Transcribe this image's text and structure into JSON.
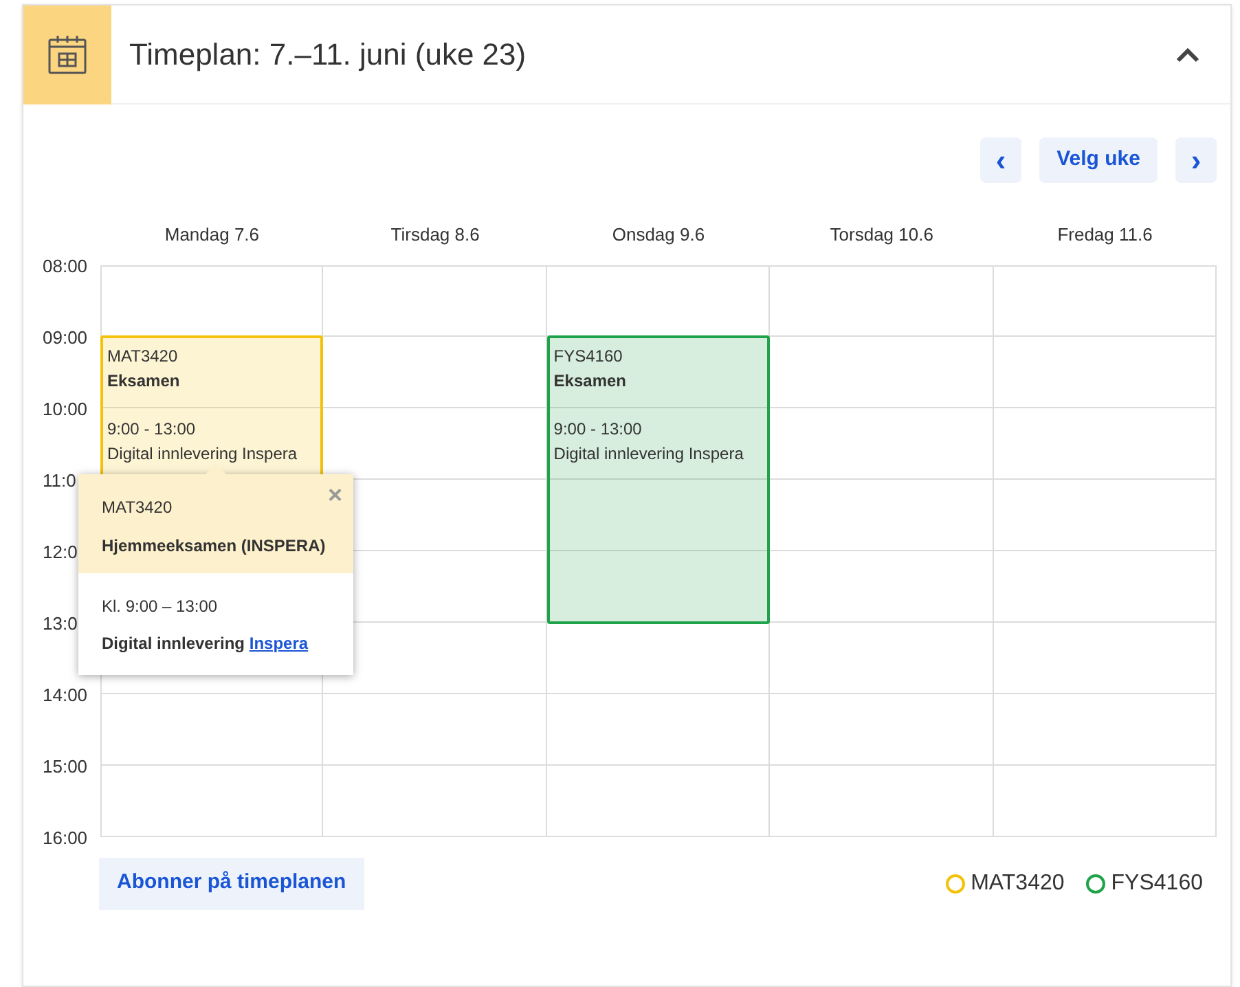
{
  "header": {
    "title": "Timeplan: 7.–11. juni (uke 23)",
    "expanded": true
  },
  "nav": {
    "prev": "‹",
    "choose_week": "Velg uke",
    "next": "›"
  },
  "days": [
    "Mandag 7.6",
    "Tirsdag 8.6",
    "Onsdag 9.6",
    "Torsdag 10.6",
    "Fredag 11.6"
  ],
  "hours": [
    "08:00",
    "09:00",
    "10:00",
    "11:0",
    "12:0",
    "13:0",
    "14:00",
    "15:00",
    "16:00"
  ],
  "events": [
    {
      "course": "MAT3420",
      "title": "Eksamen",
      "time": "9:00 - 13:00",
      "location": "Digital innlevering Inspera",
      "color": "#f4c20d"
    },
    {
      "course": "FYS4160",
      "title": "Eksamen",
      "time": "9:00 - 13:00",
      "location": "Digital innlevering Inspera",
      "color": "#1fa34a"
    }
  ],
  "popover": {
    "course": "MAT3420",
    "title": "Hjemmeeksamen (INSPERA)",
    "close": "×",
    "time": "Kl. 9:00 – 13:00",
    "location": "Digital innlevering ",
    "link": "Inspera"
  },
  "subscribe": "Abonner på timeplanen",
  "legend": [
    {
      "label": "MAT3420",
      "color": "#f4c20d"
    },
    {
      "label": "FYS4160",
      "color": "#1fa34a"
    }
  ]
}
